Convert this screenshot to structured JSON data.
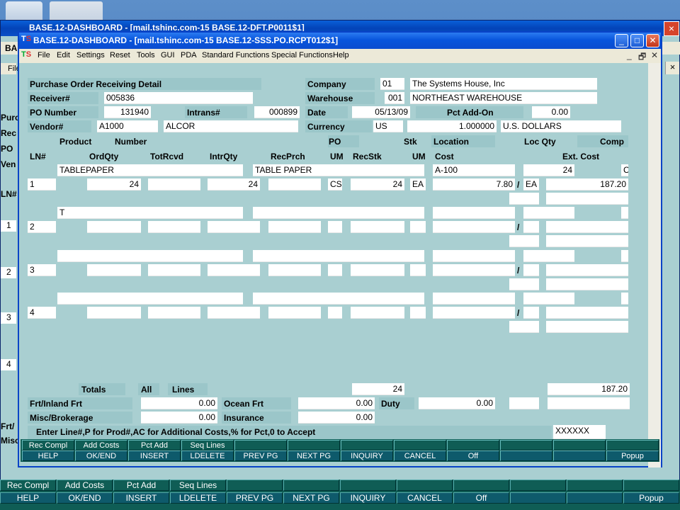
{
  "back_window": {
    "title": "BASE.12-DASHBOARD - [mail.tshinc.com-15 BASE.12-DFT.P0011$1]",
    "left_labels": [
      "Purc",
      "Rec",
      "PO",
      "Ven",
      "LN#",
      "1",
      "2",
      "3",
      "4",
      "Frt/",
      "Misc"
    ],
    "menu_fragments": [
      "BA",
      "File"
    ],
    "close": "×",
    "keys_top": [
      "Rec Compl",
      "Add Costs",
      "Pct Add",
      "Seq Lines",
      "",
      "",
      "",
      "",
      "",
      "",
      "",
      ""
    ],
    "keys_bottom": [
      "HELP",
      "OK/END",
      "INSERT",
      "LDELETE",
      "PREV PG",
      "NEXT PG",
      "INQUIRY",
      "CANCEL",
      "Off",
      "",
      "",
      "Popup"
    ]
  },
  "window": {
    "title": "BASE.12-DASHBOARD - [mail.tshinc.com-15 BASE.12-SSS.PO.RCPT012$1]",
    "logo_t": "T",
    "logo_s": "S",
    "minimize": "_",
    "maximize": "□",
    "close": "✕",
    "menu": [
      "File",
      "Edit",
      "Settings",
      "Reset",
      "Tools",
      "GUI",
      "PDA",
      "Standard Functions",
      "Special Functions",
      "Help"
    ],
    "menu_controls": [
      "_",
      "🗗",
      "✕"
    ]
  },
  "form": {
    "title": "Purchase Order Receiving Detail",
    "labels": {
      "receiver": "Receiver#",
      "po_number": "PO Number",
      "intrans": "Intrans#",
      "vendor": "Vendor#",
      "company": "Company",
      "warehouse": "Warehouse",
      "date": "Date",
      "pct_addon": "Pct Add-On",
      "currency": "Currency"
    },
    "values": {
      "receiver": "005836",
      "po_number": "131940",
      "intrans": "000899",
      "vendor_code": "A1000",
      "vendor_name": "ALCOR",
      "company_code": "01",
      "company_name": "The Systems House, Inc",
      "warehouse_code": "001",
      "warehouse_name": "NORTHEAST WAREHOUSE",
      "date": "05/13/09",
      "pct_addon": "0.00",
      "currency_code": "US",
      "currency_rate": "1.000000",
      "currency_name": "U.S. DOLLARS"
    },
    "col_headers_row1": {
      "product": "Product",
      "number": "Number",
      "po": "PO",
      "stk": "Stk",
      "location": "Location",
      "loc_qty": "Loc Qty",
      "comp": "Comp"
    },
    "col_headers_row2": {
      "ln": "LN#",
      "ordqty": "OrdQty",
      "totrcvd": "TotRcvd",
      "intrqty": "IntrQty",
      "recprch": "RecPrch",
      "um": "UM",
      "recstk": "RecStk",
      "um2": "UM",
      "cost": "Cost",
      "ext_cost": "Ext. Cost"
    },
    "lines": [
      {
        "ln": "1",
        "product": "TABLEPAPER",
        "desc": "TABLE PAPER",
        "location": "A-100",
        "loc_qty": "24",
        "comp": "C",
        "ordqty": "24",
        "totrcvd": "",
        "intrqty": "24",
        "recprch": "",
        "po_um": "CS",
        "recstk": "24",
        "stk_um": "EA",
        "cost": "7.80",
        "slash": "/",
        "cost_um": "EA",
        "ext_cost": "187.20"
      },
      {
        "ln": "2",
        "product": "T",
        "desc": "",
        "location": "",
        "loc_qty": "",
        "comp": "",
        "ordqty": "",
        "totrcvd": "",
        "intrqty": "",
        "recprch": "",
        "po_um": "",
        "recstk": "",
        "stk_um": "",
        "cost": "",
        "slash": "/",
        "cost_um": "",
        "ext_cost": ""
      },
      {
        "ln": "3",
        "product": "",
        "desc": "",
        "location": "",
        "loc_qty": "",
        "comp": "",
        "ordqty": "",
        "totrcvd": "",
        "intrqty": "",
        "recprch": "",
        "po_um": "",
        "recstk": "",
        "stk_um": "",
        "cost": "",
        "slash": "/",
        "cost_um": "",
        "ext_cost": ""
      },
      {
        "ln": "4",
        "product": "",
        "desc": "",
        "location": "",
        "loc_qty": "",
        "comp": "",
        "ordqty": "",
        "totrcvd": "",
        "intrqty": "",
        "recprch": "",
        "po_um": "",
        "recstk": "",
        "stk_um": "",
        "cost": "",
        "slash": "/",
        "cost_um": "",
        "ext_cost": ""
      }
    ],
    "totals": {
      "label": "Totals",
      "all": "All",
      "lines": "Lines",
      "recstk_total": "24",
      "ext_total": "187.20",
      "frt_label": "Frt/Inland Frt",
      "frt": "0.00",
      "ocean_label": "Ocean Frt",
      "ocean": "0.00",
      "duty_label": "Duty",
      "duty": "0.00",
      "misc_label": "Misc/Brokerage",
      "misc": "0.00",
      "insurance_label": "Insurance",
      "insurance": "0.00"
    },
    "prompt": "Enter Line#,P for Prod#,AC for Additional Costs,% for Pct,0 to Accept",
    "prompt_input": "XXXXXX"
  },
  "function_keys": {
    "top": [
      "Rec Compl",
      "Add Costs",
      "Pct Add",
      "Seq Lines",
      "",
      "",
      "",
      "",
      "",
      "",
      "",
      ""
    ],
    "bottom": [
      "HELP",
      "OK/END",
      "INSERT",
      "LDELETE",
      "PREV PG",
      "NEXT PG",
      "INQUIRY",
      "CANCEL",
      "Off",
      "",
      "",
      "Popup"
    ]
  }
}
